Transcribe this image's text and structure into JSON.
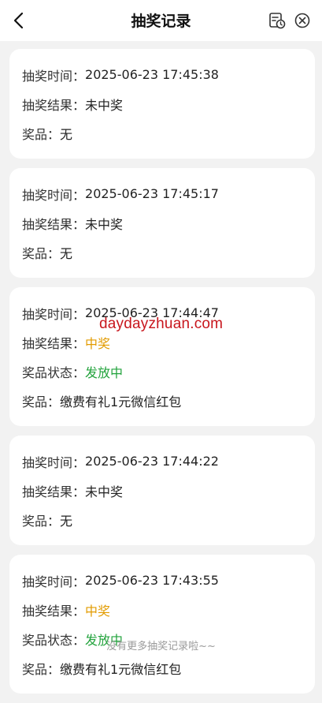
{
  "header": {
    "title": "抽奖记录",
    "back_icon": "chevron-left-icon",
    "history_icon": "clock-document-icon",
    "close_icon": "close-circle-icon"
  },
  "labels": {
    "time": "抽奖时间：",
    "result": "抽奖结果：",
    "status": "奖品状态：",
    "prize": "奖品："
  },
  "records": [
    {
      "time": "2025-06-23 17:45:38",
      "result": "未中奖",
      "prize": "无"
    },
    {
      "time": "2025-06-23 17:45:17",
      "result": "未中奖",
      "prize": "无"
    },
    {
      "time": "2025-06-23 17:44:47",
      "result": "中奖",
      "status": "发放中",
      "prize": "缴费有礼1元微信红包"
    },
    {
      "time": "2025-06-23 17:44:22",
      "result": "未中奖",
      "prize": "无"
    },
    {
      "time": "2025-06-23 17:43:55",
      "result": "中奖",
      "status": "发放中",
      "prize": "缴费有礼1元微信红包"
    }
  ],
  "watermark": "daydayzhuan.com",
  "footer": "没有更多抽奖记录啦~~",
  "colors": {
    "win": "#e29b00",
    "status": "#22a33c",
    "watermark": "#c8161d",
    "background": "#f2f2f2"
  }
}
